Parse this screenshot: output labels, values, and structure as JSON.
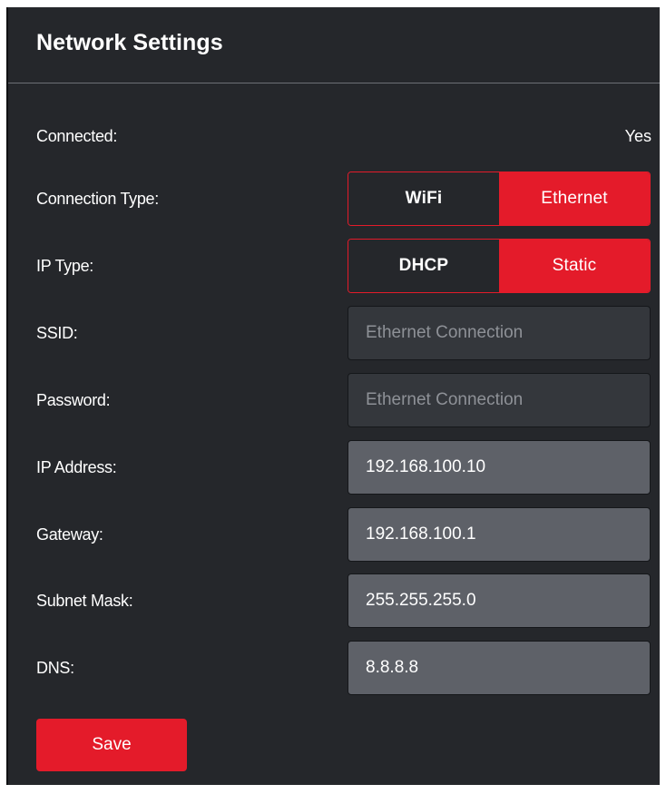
{
  "panel": {
    "title": "Network Settings"
  },
  "connected": {
    "label": "Connected:",
    "value": "Yes"
  },
  "connection_type": {
    "label": "Connection Type:",
    "options": [
      "WiFi",
      "Ethernet"
    ],
    "selected": "Ethernet"
  },
  "ip_type": {
    "label": "IP Type:",
    "options": [
      "DHCP",
      "Static"
    ],
    "selected": "Static"
  },
  "ssid": {
    "label": "SSID:",
    "placeholder": "Ethernet Connection",
    "value": ""
  },
  "password": {
    "label": "Password:",
    "placeholder": "Ethernet Connection",
    "value": ""
  },
  "ip_address": {
    "label": "IP Address:",
    "value": "192.168.100.10"
  },
  "gateway": {
    "label": "Gateway:",
    "value": "192.168.100.1"
  },
  "subnet_mask": {
    "label": "Subnet Mask:",
    "value": "255.255.255.0"
  },
  "dns": {
    "label": "DNS:",
    "value": "8.8.8.8"
  },
  "save_button": {
    "label": "Save"
  },
  "colors": {
    "accent": "#e41b2a",
    "panel_background": "#25272b",
    "input_background": "#5e6168",
    "disabled_input_background": "#34373c"
  }
}
